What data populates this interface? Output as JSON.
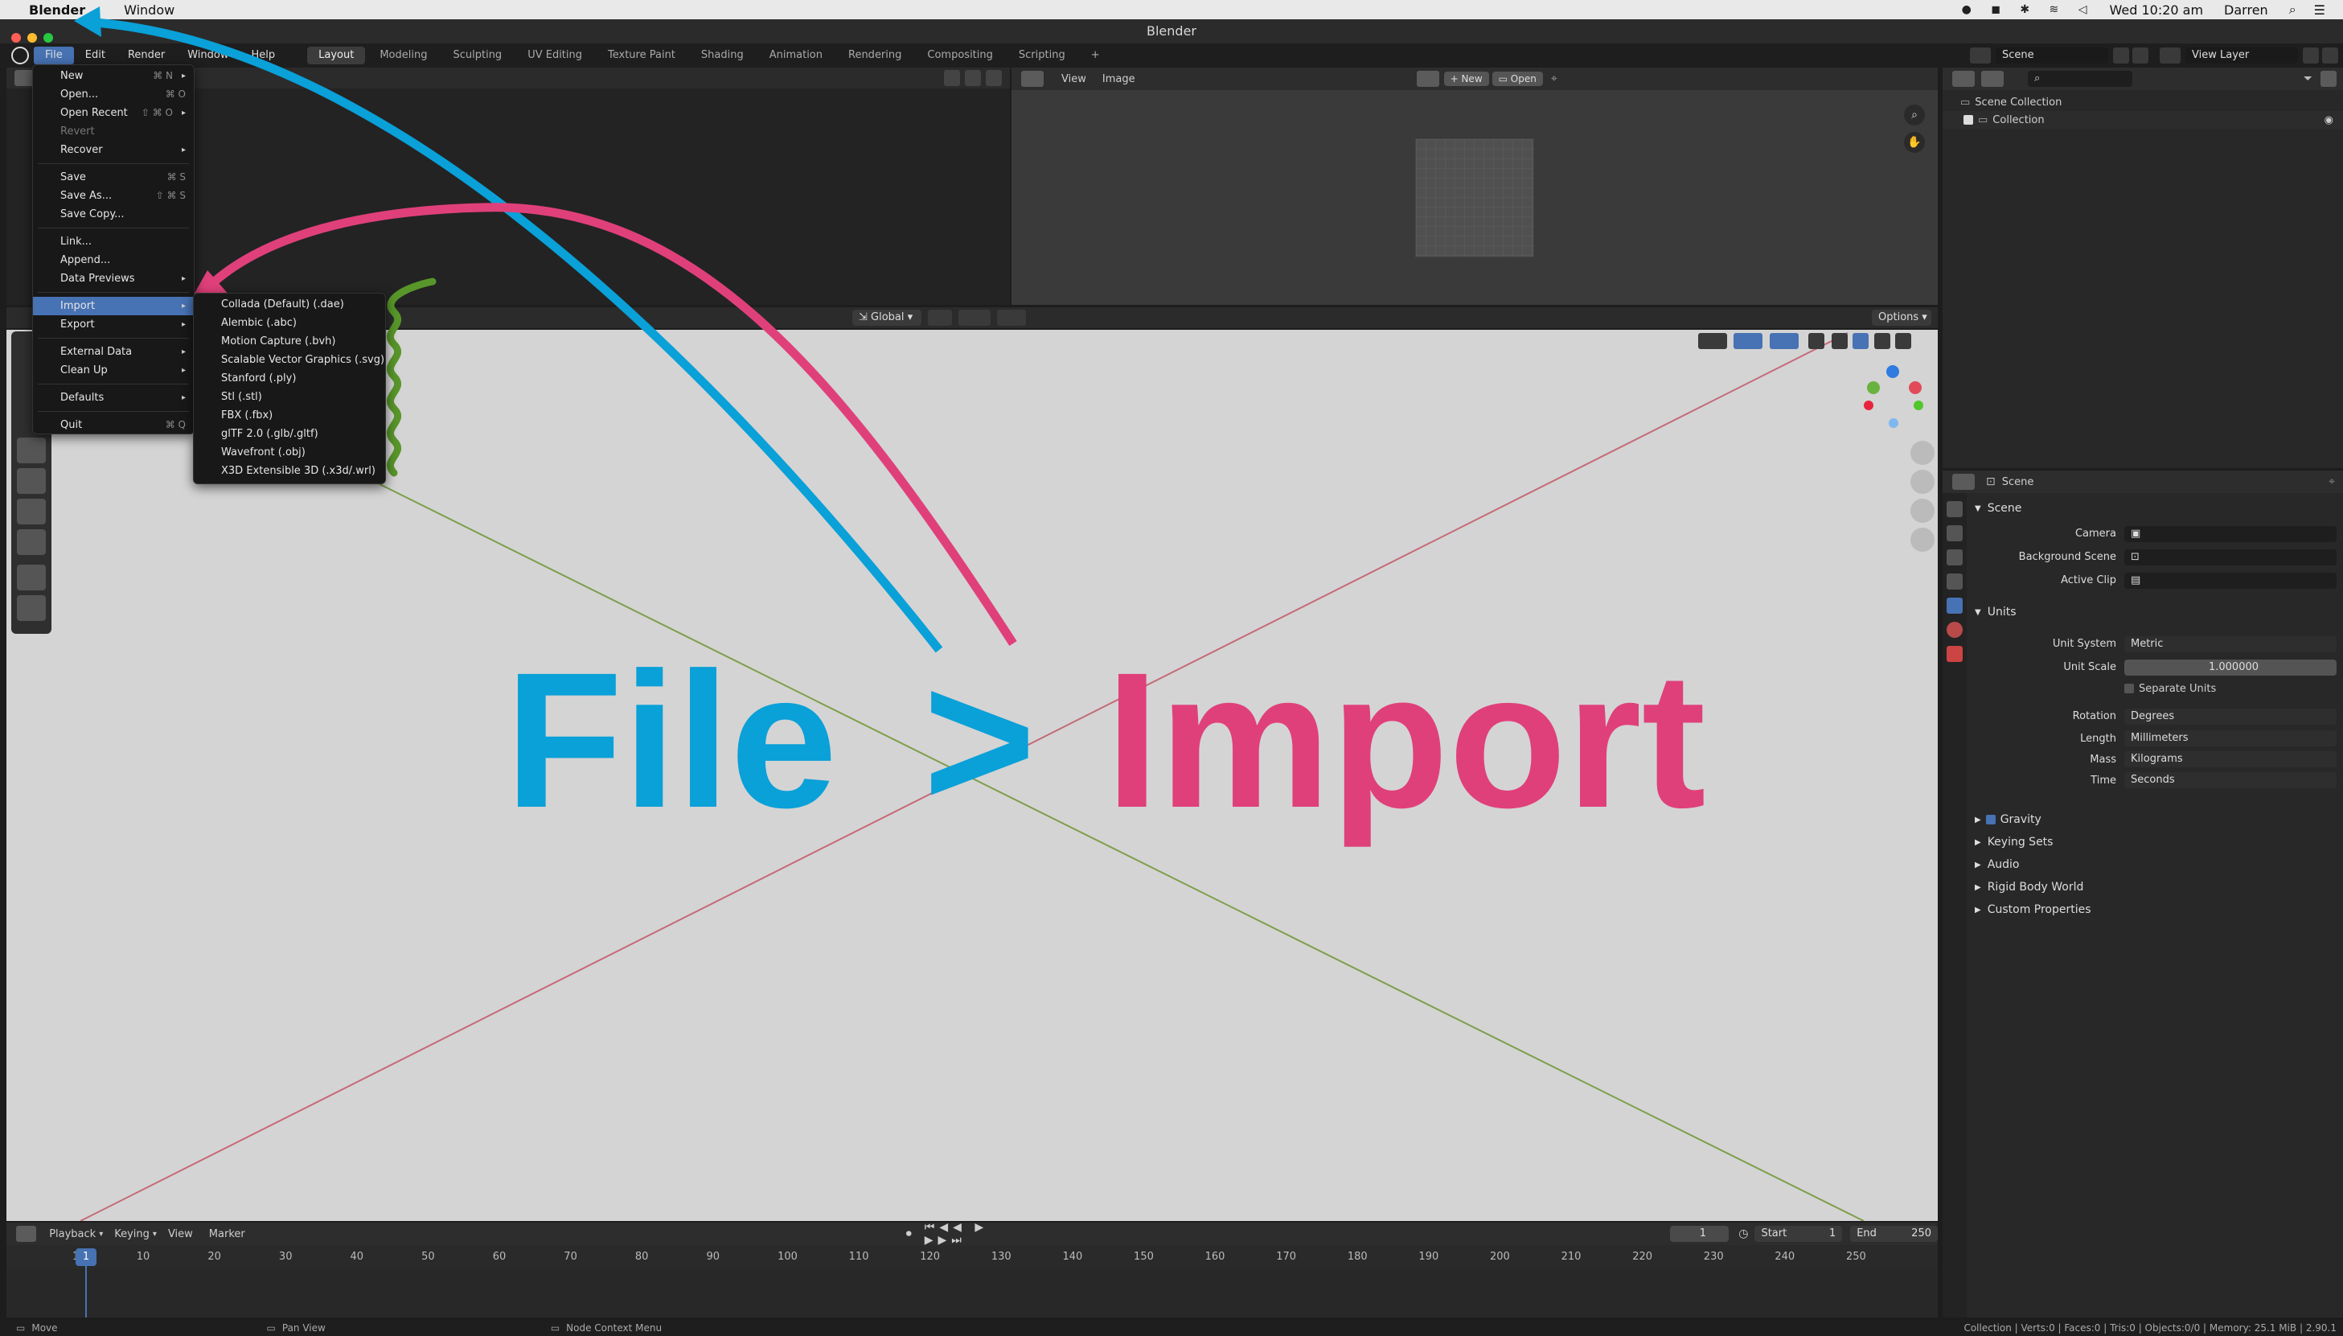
{
  "mac": {
    "app": "Blender",
    "window_menu": "Window",
    "datetime": "Wed 10:20 am",
    "user": "Darren"
  },
  "window_title": "Blender",
  "topbar": {
    "menus": [
      "File",
      "Edit",
      "Render",
      "Window",
      "Help"
    ],
    "workspaces": [
      "Layout",
      "Modeling",
      "Sculpting",
      "UV Editing",
      "Texture Paint",
      "Shading",
      "Animation",
      "Rendering",
      "Compositing",
      "Scripting"
    ],
    "active_workspace": "Layout",
    "scene": "Scene",
    "view_layer": "View Layer"
  },
  "file_menu": {
    "items": [
      {
        "label": "New",
        "shortcut": "⌘ N",
        "submenu": true
      },
      {
        "label": "Open...",
        "shortcut": "⌘ O"
      },
      {
        "label": "Open Recent",
        "shortcut": "⇧ ⌘ O",
        "submenu": true
      },
      {
        "label": "Revert",
        "disabled": true
      },
      {
        "label": "Recover",
        "submenu": true
      },
      {
        "sep": true
      },
      {
        "label": "Save",
        "shortcut": "⌘ S"
      },
      {
        "label": "Save As...",
        "shortcut": "⇧ ⌘ S"
      },
      {
        "label": "Save Copy..."
      },
      {
        "sep": true
      },
      {
        "label": "Link..."
      },
      {
        "label": "Append..."
      },
      {
        "label": "Data Previews",
        "submenu": true
      },
      {
        "sep": true
      },
      {
        "label": "Import",
        "submenu": true,
        "highlight": true
      },
      {
        "label": "Export",
        "submenu": true
      },
      {
        "sep": true
      },
      {
        "label": "External Data",
        "submenu": true
      },
      {
        "label": "Clean Up",
        "submenu": true
      },
      {
        "sep": true
      },
      {
        "label": "Defaults",
        "submenu": true
      },
      {
        "sep": true
      },
      {
        "label": "Quit",
        "shortcut": "⌘ Q"
      }
    ]
  },
  "import_menu": [
    "Collada (Default) (.dae)",
    "Alembic (.abc)",
    "Motion Capture (.bvh)",
    "Scalable Vector Graphics (.svg)",
    "Stanford (.ply)",
    "Stl (.stl)",
    "FBX (.fbx)",
    "glTF 2.0 (.glb/.gltf)",
    "Wavefront (.obj)",
    "X3D Extensible 3D (.x3d/.wrl)"
  ],
  "image_editor": {
    "view": "View",
    "image": "Image",
    "new": "New",
    "open": "Open"
  },
  "viewport": {
    "transform_orientation": "Global",
    "options": "Options"
  },
  "overlay": {
    "file": "File",
    "gt": ">",
    "import": "Import"
  },
  "colors": {
    "blue": "#0aa0d8",
    "pink": "#e0407a",
    "green": "#58962a",
    "accent": "#4772b3"
  },
  "outliner": {
    "scene_collection": "Scene Collection",
    "collection": "Collection"
  },
  "properties": {
    "header": "Scene",
    "scene_section": "Scene",
    "camera": "Camera",
    "background_scene": "Background Scene",
    "active_clip": "Active Clip",
    "units_section": "Units",
    "unit_system": {
      "label": "Unit System",
      "value": "Metric"
    },
    "unit_scale": {
      "label": "Unit Scale",
      "value": "1.000000"
    },
    "separate_units": "Separate Units",
    "rotation": {
      "label": "Rotation",
      "value": "Degrees"
    },
    "length": {
      "label": "Length",
      "value": "Millimeters"
    },
    "mass": {
      "label": "Mass",
      "value": "Kilograms"
    },
    "time": {
      "label": "Time",
      "value": "Seconds"
    },
    "panels": [
      "Gravity",
      "Keying Sets",
      "Audio",
      "Rigid Body World",
      "Custom Properties"
    ]
  },
  "timeline": {
    "menus": [
      "Playback",
      "Keying",
      "View",
      "Marker"
    ],
    "current_frame": "1",
    "start_label": "Start",
    "start": "1",
    "end_label": "End",
    "end": "250",
    "ticks": [
      "1",
      "10",
      "20",
      "30",
      "40",
      "50",
      "60",
      "70",
      "80",
      "90",
      "100",
      "110",
      "120",
      "130",
      "140",
      "150",
      "160",
      "170",
      "180",
      "190",
      "200",
      "210",
      "220",
      "230",
      "240",
      "250"
    ]
  },
  "statusbar": {
    "move": "Move",
    "pan": "Pan View",
    "node": "Node Context Menu",
    "stats": "Collection | Verts:0 | Faces:0 | Tris:0 | Objects:0/0 | Memory: 25.1 MiB | 2.90.1"
  }
}
